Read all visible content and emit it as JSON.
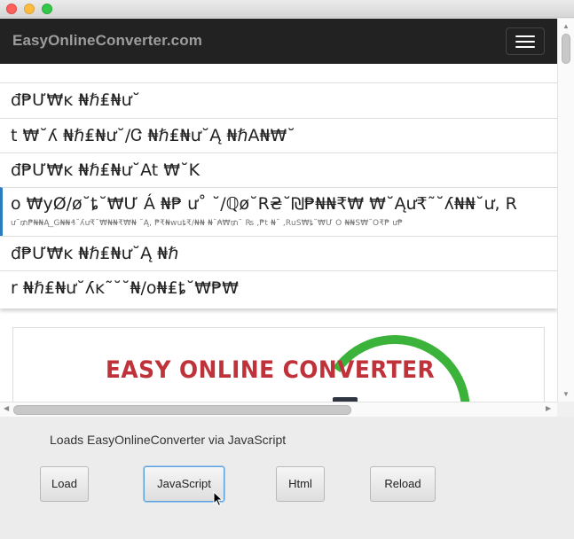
{
  "navbar": {
    "brand": "EasyOnlineConverter.com"
  },
  "menu": {
    "items": [
      {
        "label": "đ₱Ư₩ĸ ₦ℏ₤₦ư˘"
      },
      {
        "label": "t ₩˘ʎ ₦ℏ₤₦ư˘/Ꮳ ₦ℏ₤₦ư˘Ą ₦ℏA₦₩˘"
      },
      {
        "label": "đ₱Ư₩ĸ ₦ℏ₤₦ư˘At ₩˘K"
      },
      {
        "label": "o ₩yØ/ø˘ȶ˘₩Ư Á ₦₱ ư˚ ˘/ℚø˘R₴˘₪₱₦₦₹₩ ₩˘Ąư₹˜˘ʎ₦₦˘ư, R",
        "sub": "ư˜₥₱₦₦Ą_G₦₦₰˘ʎư₹˘₩₦₦₹₩₦ ˘Ą, ₱₹₦wuȶ₹/₦₦ ₦˘₳₩₥˘ ₨ ,₱t ₦˘ ,RuS₩ȶ˘₩Ư O ₦₦S₩˘O₹₱ ư₱",
        "active": true
      },
      {
        "label": "đ₱Ư₩ĸ ₦ℏ₤₦ư˘Ą ₦ℏ"
      },
      {
        "label": "r ₦ℏ₤₦ư˘ʎĸ˜˘˘₦/o₦₤ȶ˘₩₱₩"
      }
    ]
  },
  "logo": {
    "text": "EASY ONLINE CONVERTER"
  },
  "controls": {
    "status": "Loads EasyOnlineConverter via JavaScript",
    "buttons": {
      "load": "Load",
      "javascript": "JavaScript",
      "html": "Html",
      "reload": "Reload"
    }
  },
  "colors": {
    "navbar_bg": "#222222",
    "brand_text": "#9d9d9d",
    "logo_red": "#c0323a",
    "logo_green": "#3bb33b",
    "active_border": "#2a7bbf",
    "focus_ring": "#5aa0dc"
  },
  "icons": {
    "menu": "hamburger-menu-icon",
    "cursor": "mouse-pointer-icon"
  }
}
